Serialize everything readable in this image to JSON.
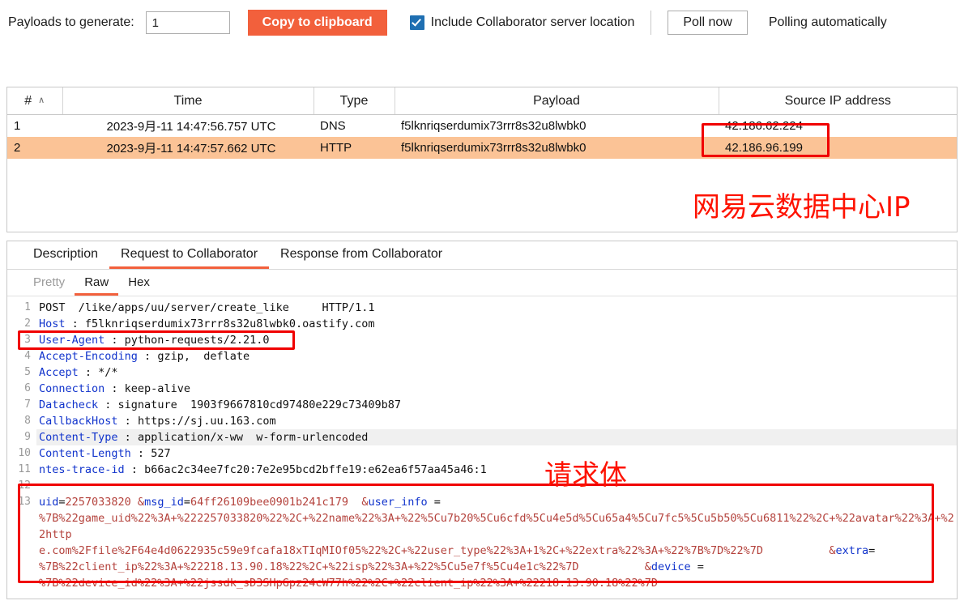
{
  "toolbar": {
    "payloads_label": "Payloads to generate:",
    "payloads_value": "1",
    "copy_button": "Copy to clipboard",
    "include_location_label": "Include Collaborator server location",
    "poll_now_button": "Poll now",
    "polling_status": "Polling automatically",
    "accent_color": "#f2603c",
    "checkbox_color": "#1f6fb2"
  },
  "interactions_table": {
    "columns": [
      "#",
      "Time",
      "Type",
      "Payload",
      "Source IP address"
    ],
    "sort_indicator": "∧",
    "rows": [
      {
        "num": "1",
        "time": "2023-9月-11 14:47:56.757 UTC",
        "type": "DNS",
        "payload": "f5lknriqserdumix73rrr8s32u8lwbk0",
        "source_ip": "42.186.62.224",
        "selected": false
      },
      {
        "num": "2",
        "time": "2023-9月-11 14:47:57.662 UTC",
        "type": "HTTP",
        "payload": "f5lknriqserdumix73rrr8s32u8lwbk0",
        "source_ip": "42.186.96.199",
        "selected": true
      }
    ],
    "selected_row_color": "#fbc396"
  },
  "annotations": {
    "ip_note": "网易云数据中心IP",
    "body_note": "请求体",
    "highlight_color": "#f00000"
  },
  "details": {
    "tabs": [
      {
        "label": "Description",
        "active": false
      },
      {
        "label": "Request to Collaborator",
        "active": true
      },
      {
        "label": "Response from Collaborator",
        "active": false
      }
    ],
    "subtabs": [
      {
        "label": "Pretty",
        "active": false,
        "muted": true
      },
      {
        "label": "Raw",
        "active": true,
        "muted": false
      },
      {
        "label": "Hex",
        "active": false,
        "muted": false
      }
    ]
  },
  "request": {
    "lines": [
      {
        "n": "1",
        "key": "",
        "sep": "",
        "value": "POST  /like/apps/uu/server/create_like     HTTP/1.1",
        "plain": true,
        "shaded": false
      },
      {
        "n": "2",
        "key": "Host",
        "sep": " : ",
        "value": "f5lknriqserdumix73rrr8s32u8lwbk0.oastify.com",
        "plain": false,
        "shaded": false
      },
      {
        "n": "3",
        "key": "User-Agent",
        "sep": " : ",
        "value": "python-requests/2.21.0",
        "plain": false,
        "shaded": false
      },
      {
        "n": "4",
        "key": "Accept-Encoding",
        "sep": " : ",
        "value": "gzip,  deflate",
        "plain": false,
        "shaded": false
      },
      {
        "n": "5",
        "key": "Accept",
        "sep": " : ",
        "value": "*/*",
        "plain": false,
        "shaded": false
      },
      {
        "n": "6",
        "key": "Connection",
        "sep": " : ",
        "value": "keep-alive",
        "plain": false,
        "shaded": false
      },
      {
        "n": "7",
        "key": "Datacheck",
        "sep": " : ",
        "value": "signature  1903f9667810cd97480e229c73409b87",
        "plain": false,
        "shaded": false
      },
      {
        "n": "8",
        "key": "CallbackHost",
        "sep": " : ",
        "value": "https://sj.uu.163.com",
        "plain": false,
        "shaded": false
      },
      {
        "n": "9",
        "key": "Content-Type",
        "sep": " : ",
        "value": "application/x-ww  w-form-urlencoded",
        "plain": false,
        "shaded": true
      },
      {
        "n": "10",
        "key": "Content-Length",
        "sep": " : ",
        "value": "527",
        "plain": false,
        "shaded": false
      },
      {
        "n": "11",
        "key": "ntes-trace-id",
        "sep": " : ",
        "value": "b66ac2c34ee7fc20:7e2e95bcd2bffe19:e62ea6f57aa45a46:1",
        "plain": false,
        "shaded": false
      },
      {
        "n": "12",
        "key": "",
        "sep": "",
        "value": "",
        "plain": true,
        "shaded": false
      }
    ],
    "body_line_number": "13",
    "body_segments": [
      {
        "t": "uid",
        "k": true
      },
      {
        "t": "=",
        "k": false,
        "eq": true
      },
      {
        "t": "2257033820 &",
        "k": false
      },
      {
        "t": "msg_id",
        "k": true
      },
      {
        "t": "=",
        "k": false,
        "eq": true
      },
      {
        "t": "64ff26109bee0901b241c179  &",
        "k": false
      },
      {
        "t": "user_info",
        "k": true
      },
      {
        "t": " = ",
        "k": false,
        "eq": true
      },
      {
        "t": "\n%7B%22game_uid%22%3A+%222257033820%22%2C+%22name%22%3A+%22%5Cu7b20%5Cu6cfd%5Cu4e5d%5Cu65a4%5Cu7fc5%5Cu5b50%5Cu6811%22%2C+%22avatar%22%3A+%22http\ne.com%2Ffile%2F64e4d0622935c59e9fcafa18xTIqMIOf05%22%2C+%22user_type%22%3A+1%2C+%22extra%22%3A+%22%7B%7D%22%7D          &",
        "k": false
      },
      {
        "t": "extra",
        "k": true
      },
      {
        "t": "=",
        "k": false,
        "eq": true
      },
      {
        "t": "\n%7B%22client_ip%22%3A+%22218.13.90.18%22%2C+%22isp%22%3A+%22%5Cu5e7f%5Cu4e1c%22%7D          &",
        "k": false
      },
      {
        "t": "device",
        "k": true
      },
      {
        "t": " = ",
        "k": false,
        "eq": true
      },
      {
        "t": "\n%7B%22device_id%22%3A+%22jssdk_sD3SHpGpz24cW77h%22%2C+%22client_ip%22%3A+%22218.13.90.18%22%7D",
        "k": false
      }
    ]
  }
}
